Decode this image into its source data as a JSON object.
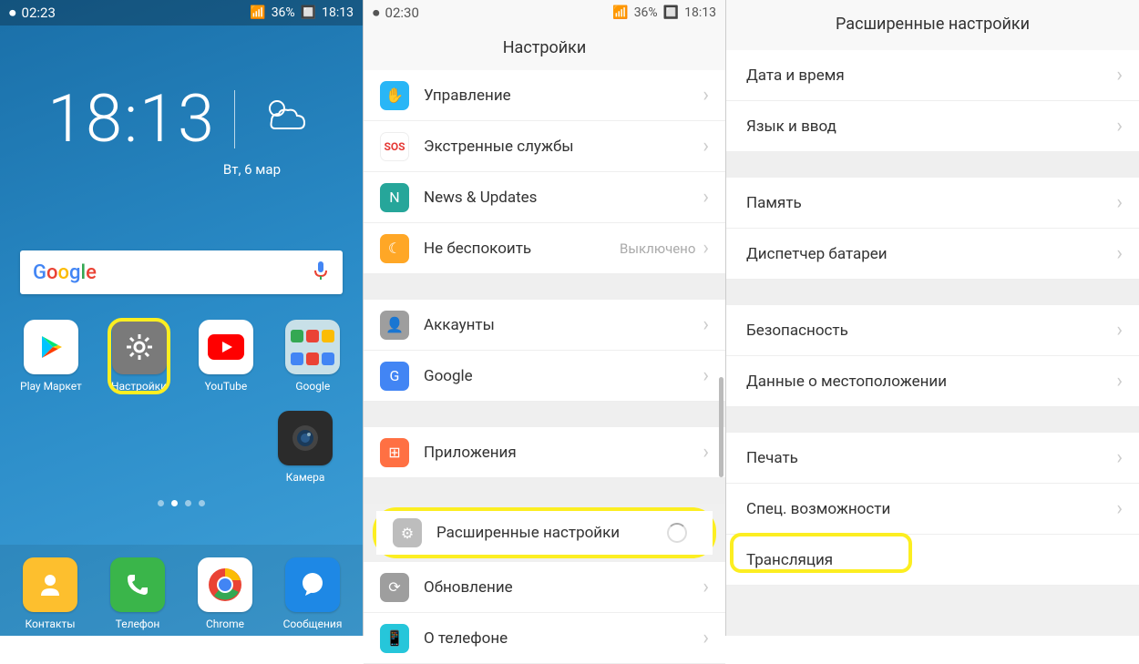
{
  "panel1": {
    "status_left": "02:23",
    "status_signal": "36%",
    "status_time": "18:13",
    "clock_time": "18:13",
    "clock_date": "Вт, 6 мар",
    "apps": [
      {
        "label": "Play Маркет"
      },
      {
        "label": "Настройки"
      },
      {
        "label": "YouTube"
      },
      {
        "label": "Google"
      }
    ],
    "camera_label": "Камера",
    "dock": [
      {
        "label": "Контакты"
      },
      {
        "label": "Телефон"
      },
      {
        "label": "Chrome"
      },
      {
        "label": "Сообщения"
      }
    ]
  },
  "panel2": {
    "status_left": "02:30",
    "status_signal": "36%",
    "status_time": "18:13",
    "title": "Настройки",
    "rows": [
      {
        "label": "Управление"
      },
      {
        "label": "Экстренные службы"
      },
      {
        "label": "News & Updates"
      },
      {
        "label": "Не беспокоить",
        "value": "Выключено"
      },
      {
        "label": "Аккаунты"
      },
      {
        "label": "Google"
      },
      {
        "label": "Приложения"
      },
      {
        "label": "Расширенные настройки"
      },
      {
        "label": "Обновление"
      },
      {
        "label": "О телефоне"
      }
    ]
  },
  "panel3": {
    "title": "Расширенные настройки",
    "rows": [
      {
        "label": "Дата и время"
      },
      {
        "label": "Язык и ввод"
      },
      {
        "label": "Память"
      },
      {
        "label": "Диспетчер батареи"
      },
      {
        "label": "Безопасность"
      },
      {
        "label": "Данные о местоположении"
      },
      {
        "label": "Печать"
      },
      {
        "label": "Спец. возможности"
      },
      {
        "label": "Трансляция"
      }
    ]
  }
}
